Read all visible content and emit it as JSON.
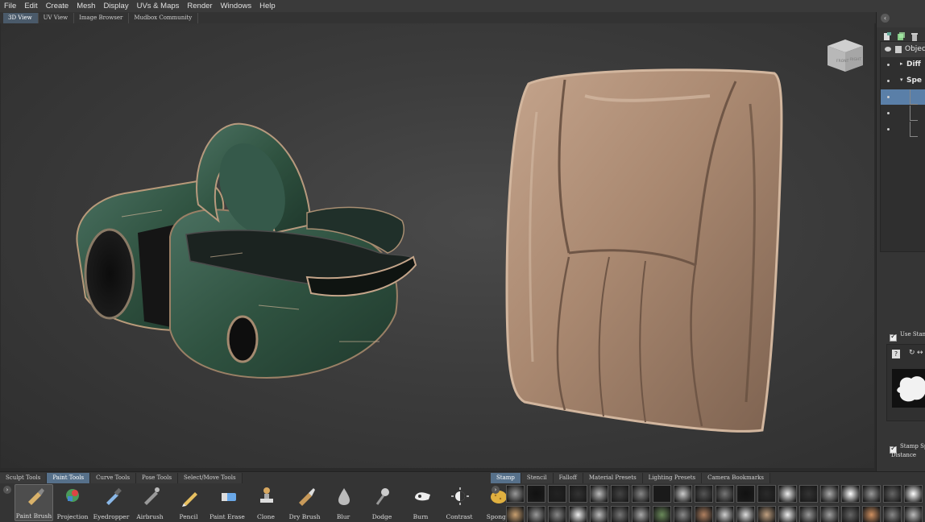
{
  "menu": [
    "File",
    "Edit",
    "Create",
    "Mesh",
    "Display",
    "UVs & Maps",
    "Render",
    "Windows",
    "Help"
  ],
  "view_tabs": [
    {
      "label": "3D View",
      "active": true
    },
    {
      "label": "UV View",
      "active": false
    },
    {
      "label": "Image Browser",
      "active": false
    },
    {
      "label": "Mudbox Community",
      "active": false
    }
  ],
  "viewcube": {
    "front": "FRONT",
    "right": "RIGHT"
  },
  "right_panel": {
    "collapse_icon": "chevron-left-icon",
    "outliner_rows": [
      {
        "label": "Objec",
        "kind": "header"
      },
      {
        "label": "Diff",
        "kind": "collapsed"
      },
      {
        "label": "Spe",
        "kind": "expanded"
      },
      {
        "label": "",
        "kind": "selected"
      },
      {
        "label": "",
        "kind": "child"
      },
      {
        "label": "",
        "kind": "child"
      }
    ],
    "use_stamp_label": "Use Stam",
    "stamp_spacing_label": "Stamp Sp",
    "distance_label": "Distance",
    "help_label": "?"
  },
  "tool_tabs": [
    {
      "label": "Sculpt Tools",
      "active": false
    },
    {
      "label": "Paint Tools",
      "active": true
    },
    {
      "label": "Curve Tools",
      "active": false
    },
    {
      "label": "Pose Tools",
      "active": false
    },
    {
      "label": "Select/Move Tools",
      "active": false
    }
  ],
  "paint_tools": [
    {
      "label": "Paint Brush",
      "icon": "paint-brush-icon",
      "active": true
    },
    {
      "label": "Projection",
      "icon": "projection-icon",
      "active": false
    },
    {
      "label": "Eyedropper",
      "icon": "eyedropper-icon",
      "active": false
    },
    {
      "label": "Airbrush",
      "icon": "airbrush-icon",
      "active": false
    },
    {
      "label": "Pencil",
      "icon": "pencil-icon",
      "active": false
    },
    {
      "label": "Paint Erase",
      "icon": "eraser-icon",
      "active": false
    },
    {
      "label": "Clone",
      "icon": "clone-stamp-icon",
      "active": false
    },
    {
      "label": "Dry Brush",
      "icon": "dry-brush-icon",
      "active": false
    },
    {
      "label": "Blur",
      "icon": "blur-drop-icon",
      "active": false
    },
    {
      "label": "Dodge",
      "icon": "dodge-icon",
      "active": false
    },
    {
      "label": "Burn",
      "icon": "burn-hand-icon",
      "active": false
    },
    {
      "label": "Contrast",
      "icon": "contrast-sun-icon",
      "active": false
    },
    {
      "label": "Sponge",
      "icon": "sponge-icon",
      "active": false
    }
  ],
  "stamp_tabs": [
    {
      "label": "Stamp",
      "active": true
    },
    {
      "label": "Stencil",
      "active": false
    },
    {
      "label": "Falloff",
      "active": false
    },
    {
      "label": "Material Presets",
      "active": false
    },
    {
      "label": "Lighting Presets",
      "active": false
    },
    {
      "label": "Camera Bookmarks",
      "active": false
    }
  ],
  "colors": {
    "accent_tab": "#56708a",
    "selection": "#5a7fa8",
    "leather": "#a98870",
    "goggles_green": "#2f5240"
  }
}
